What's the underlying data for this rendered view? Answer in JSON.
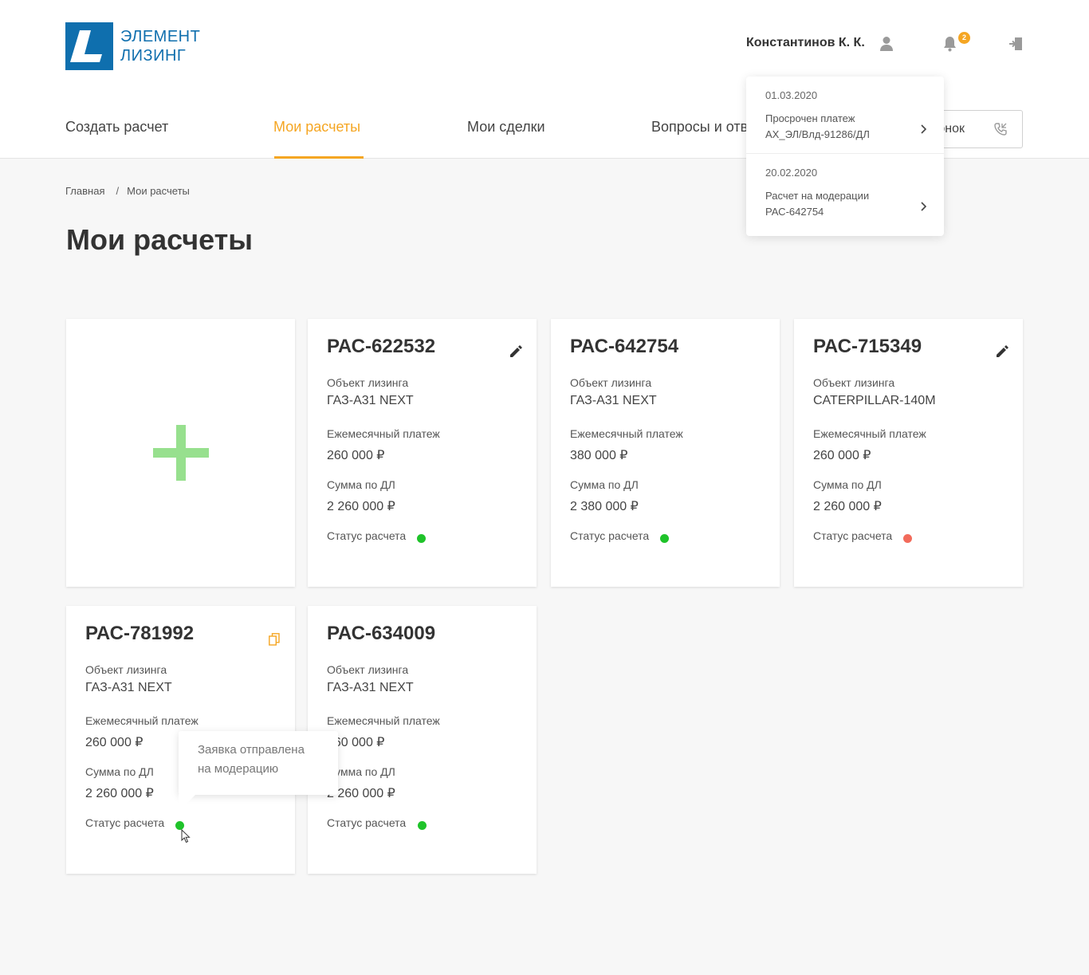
{
  "brand": {
    "line1": "ЭЛЕМЕНТ",
    "line2": "ЛИЗИНГ",
    "color": "#0f6fae"
  },
  "header": {
    "user_name": "Константинов К. К.",
    "notification_count": "2",
    "call_label": "онок"
  },
  "nav": {
    "items": [
      {
        "label": "Создать расчет"
      },
      {
        "label": "Мои расчеты"
      },
      {
        "label": "Мои сделки"
      },
      {
        "label": "Вопросы и отве"
      }
    ],
    "active_index": 1,
    "accent_color": "#f5a623"
  },
  "notifications": [
    {
      "date": "01.03.2020",
      "title": "Просрочен платеж",
      "subtitle": "AX_ЭЛ/Влд-91286/ДЛ"
    },
    {
      "date": "20.02.2020",
      "title": "Расчет на модерации",
      "subtitle": "РАС-642754"
    }
  ],
  "breadcrumb": {
    "home": "Главная",
    "separator": "/",
    "current": "Мои расчеты"
  },
  "page_title": "Мои расчеты",
  "labels": {
    "object": "Объект лизинга",
    "monthly": "Ежемесячный платеж",
    "total": "Сумма по ДЛ",
    "status": "Статус расчета"
  },
  "status_colors": {
    "ok": "#1fc32a",
    "error": "#f26b5b"
  },
  "cards": [
    {
      "id": "РАС-622532",
      "object": "ГАЗ-А31 NEXT",
      "monthly": "260 000 ₽",
      "total": "2 260 000 ₽",
      "status": "ok",
      "action_icon": "pencil-icon"
    },
    {
      "id": "РАС-642754",
      "object": "ГАЗ-А31 NEXT",
      "monthly": "380 000 ₽",
      "total": "2 380 000 ₽",
      "status": "ok",
      "action_icon": ""
    },
    {
      "id": "РАС-715349",
      "object": "CATERPILLAR-140M",
      "monthly": "260 000 ₽",
      "total": "2 260 000 ₽",
      "status": "error",
      "action_icon": "pencil-icon"
    },
    {
      "id": "РАС-781992",
      "object": "ГАЗ-А31 NEXT",
      "monthly": "260 000 ₽",
      "total": "2 260 000 ₽",
      "status": "ok",
      "action_icon": "copy-icon"
    },
    {
      "id": "РАС-634009",
      "object": "ГАЗ-А31 NEXT",
      "monthly": "260 000 ₽",
      "total": "2 260 000 ₽",
      "status": "ok",
      "action_icon": ""
    }
  ],
  "tooltip": {
    "line1": "Заявка отправлена",
    "line2": "на модерацию"
  }
}
